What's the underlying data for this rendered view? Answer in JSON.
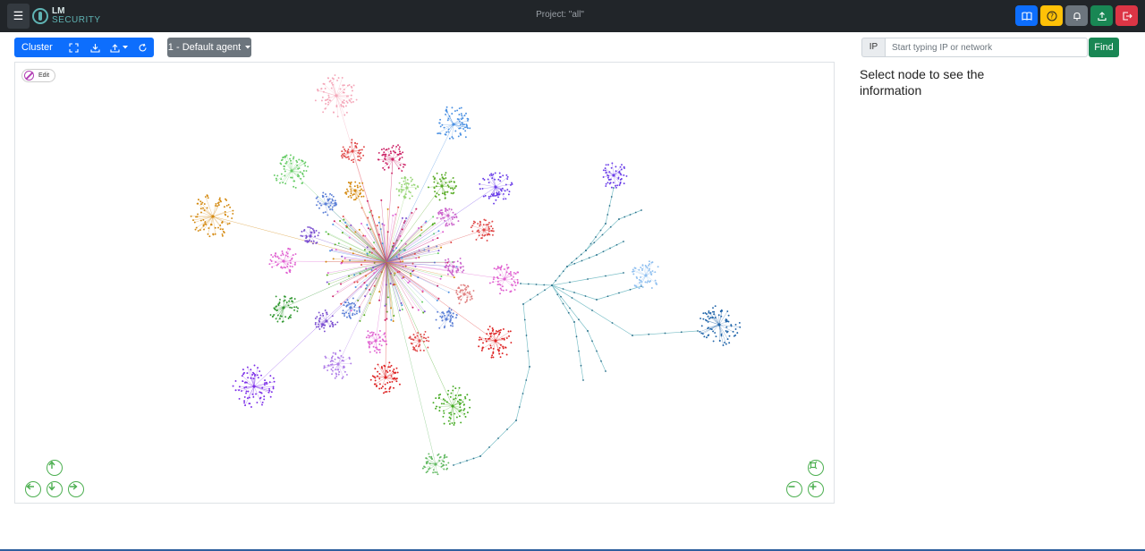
{
  "header": {
    "menu_icon": "☰",
    "logo_lm": "LM",
    "logo_security": "SECURITY",
    "project_label": "Project: \"all\""
  },
  "toolbar": {
    "cluster_label": "Cluster",
    "agent_label": "1 - Default agent"
  },
  "search": {
    "prefix": "IP",
    "placeholder": "Start typing IP or network",
    "find_label": "Find"
  },
  "info": {
    "message": "Select node to see the information"
  },
  "canvas": {
    "edit_label": "Edit"
  },
  "colors": {
    "topbar": "#212529",
    "primary": "#0d6efd",
    "warning": "#ffc107",
    "secondary": "#6c757d",
    "success": "#198754",
    "danger": "#dc3545",
    "nav_green": "#4caf50"
  }
}
